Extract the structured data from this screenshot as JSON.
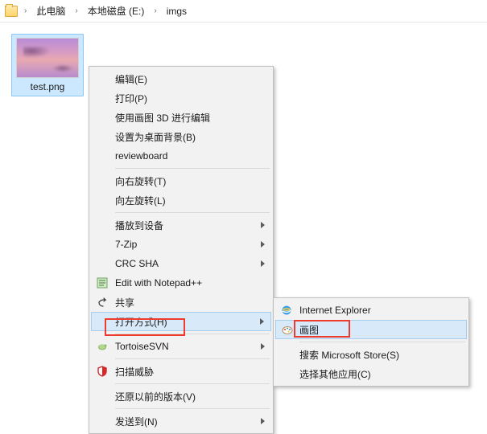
{
  "breadcrumb": {
    "items": [
      "此电脑",
      "本地磁盘 (E:)",
      "imgs"
    ]
  },
  "file": {
    "name": "test.png"
  },
  "context_menu": {
    "edit": "编辑(E)",
    "print": "打印(P)",
    "paint3d": "使用画图 3D 进行编辑",
    "setbg": "设置为桌面背景(B)",
    "reviewboard": "reviewboard",
    "rotr": "向右旋转(T)",
    "rotl": "向左旋转(L)",
    "cast": "播放到设备",
    "sevenzip": "7-Zip",
    "crcsha": "CRC SHA",
    "npp": "Edit with Notepad++",
    "share": "共享",
    "openwith": "打开方式(H)",
    "tortoisesvn": "TortoiseSVN",
    "scan": "扫描威胁",
    "restore": "还原以前的版本(V)",
    "sendto": "发送到(N)"
  },
  "openwith_sub": {
    "ie": "Internet Explorer",
    "paint": "画图",
    "store": "搜索 Microsoft Store(S)",
    "other": "选择其他应用(C)"
  }
}
